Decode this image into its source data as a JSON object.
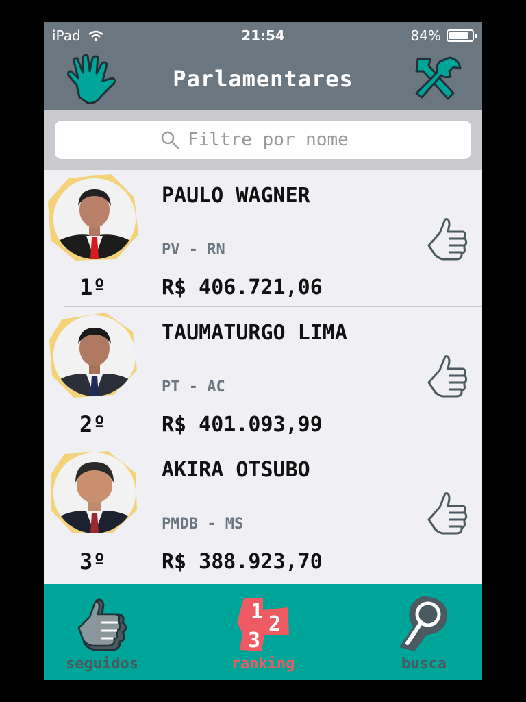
{
  "status_bar": {
    "device": "iPad",
    "time": "21:54",
    "battery": "84%",
    "battery_level": 0.84
  },
  "nav": {
    "title": "Parlamentares",
    "left_icon": "raised-hand-icon",
    "right_icon": "tools-icon"
  },
  "search": {
    "placeholder": "Filtre por nome",
    "value": ""
  },
  "list": [
    {
      "rank": "1º",
      "name": "PAULO WAGNER",
      "party": "PV - RN",
      "amount": "R$ 406.721,06"
    },
    {
      "rank": "2º",
      "name": "TAUMATURGO LIMA",
      "party": "PT - AC",
      "amount": "R$ 401.093,99"
    },
    {
      "rank": "3º",
      "name": "AKIRA OTSUBO",
      "party": "PMDB - MS",
      "amount": "R$ 388.923,70"
    }
  ],
  "tabs": [
    {
      "label": "seguidos",
      "icon": "thumbs-up-icon"
    },
    {
      "label": "ranking",
      "icon": "ranking-icon",
      "selected": true
    },
    {
      "label": "busca",
      "icon": "magnifier-icon"
    }
  ],
  "colors": {
    "bar": "#6b7780",
    "teal": "#00a599",
    "accent_red": "#ef5b63",
    "tab_inactive": "#4a5a60",
    "avatar_ring": "#f3d27a"
  }
}
